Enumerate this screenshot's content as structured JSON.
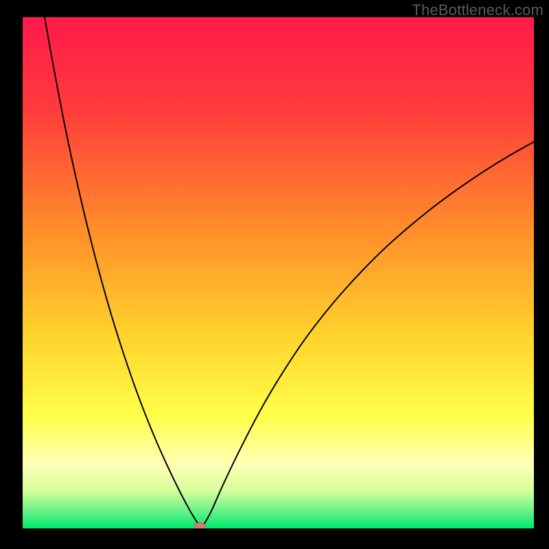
{
  "watermark": "TheBottleneck.com",
  "colors": {
    "black": "#000000",
    "red_top": "#ff1a4a",
    "orange_mid": "#ffb030",
    "yellow": "#ffff55",
    "pale_yellow": "#ffffb8",
    "green": "#00e86b",
    "curve": "#000000",
    "marker_fill": "#d47b74",
    "marker_stroke": "#b8605a"
  },
  "chart_data": {
    "type": "line",
    "title": "",
    "xlabel": "",
    "ylabel": "",
    "xlim": [
      0,
      100
    ],
    "ylim": [
      0,
      100
    ],
    "x": [
      4.3,
      5,
      6,
      8,
      10,
      12,
      14,
      16,
      18,
      20,
      22,
      24,
      26,
      28,
      30,
      31,
      32,
      33,
      34,
      34.7,
      35.5,
      37,
      39,
      42,
      46,
      50,
      55,
      60,
      65,
      70,
      75,
      80,
      85,
      90,
      95,
      100
    ],
    "y": [
      100,
      96,
      90.5,
      80,
      70.5,
      61.8,
      53.8,
      46.4,
      39.6,
      33.4,
      27.6,
      22.3,
      17.4,
      12.9,
      8.7,
      6.7,
      4.8,
      3.0,
      1.4,
      0.35,
      0.9,
      3.6,
      8.1,
      14.4,
      22.2,
      29.1,
      36.7,
      43.2,
      48.9,
      54.0,
      58.5,
      62.6,
      66.3,
      69.7,
      72.8,
      75.6
    ],
    "marker": {
      "x": 34.7,
      "y": 0.35
    },
    "gradient_stops": [
      {
        "offset": 0.0,
        "color": "#ff1a4a"
      },
      {
        "offset": 0.18,
        "color": "#ff3b3b"
      },
      {
        "offset": 0.42,
        "color": "#ff8f2b"
      },
      {
        "offset": 0.62,
        "color": "#ffd22c"
      },
      {
        "offset": 0.78,
        "color": "#ffff4a"
      },
      {
        "offset": 0.875,
        "color": "#ffffb8"
      },
      {
        "offset": 0.925,
        "color": "#d7ff9a"
      },
      {
        "offset": 0.965,
        "color": "#6cf38a"
      },
      {
        "offset": 1.0,
        "color": "#00e86b"
      }
    ]
  }
}
